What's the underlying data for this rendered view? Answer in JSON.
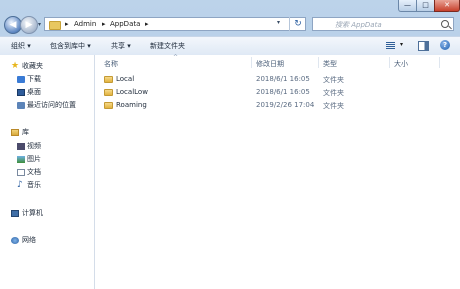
{
  "window": {
    "min": "—",
    "max": "□",
    "close": "✕"
  },
  "nav": {
    "back": "◀",
    "forward": "▶",
    "dropdown": "▾"
  },
  "address": {
    "arrow": "▸",
    "segments": [
      "Admin",
      "AppData"
    ],
    "dropdown": "▾",
    "refresh": "↻"
  },
  "search": {
    "placeholder": "搜索 AppData"
  },
  "toolbar": {
    "organize": "组织 ▾",
    "include": "包含到库中 ▾",
    "share": "共享 ▾",
    "new_folder": "新建文件夹",
    "view_dropdown": "▾",
    "help": "?"
  },
  "sidebar": {
    "favorites": {
      "label": "收藏夹",
      "items": [
        {
          "label": "下载",
          "icon": "download-icon"
        },
        {
          "label": "桌面",
          "icon": "desktop-icon"
        },
        {
          "label": "最近访问的位置",
          "icon": "recent-places-icon"
        }
      ]
    },
    "libraries": {
      "label": "库",
      "items": [
        {
          "label": "视频",
          "icon": "video-icon"
        },
        {
          "label": "图片",
          "icon": "picture-icon"
        },
        {
          "label": "文档",
          "icon": "document-icon"
        },
        {
          "label": "音乐",
          "icon": "music-icon"
        }
      ]
    },
    "computer": {
      "label": "计算机"
    },
    "network": {
      "label": "网络"
    }
  },
  "columns": {
    "name": "名称",
    "sort_arrow": "^",
    "date": "修改日期",
    "type": "类型",
    "size": "大小"
  },
  "files": [
    {
      "name": "Local",
      "date": "2018/6/1 16:05",
      "type": "文件夹"
    },
    {
      "name": "LocalLow",
      "date": "2018/6/1 16:05",
      "type": "文件夹"
    },
    {
      "name": "Roaming",
      "date": "2019/2/26 17:04",
      "type": "文件夹"
    }
  ]
}
